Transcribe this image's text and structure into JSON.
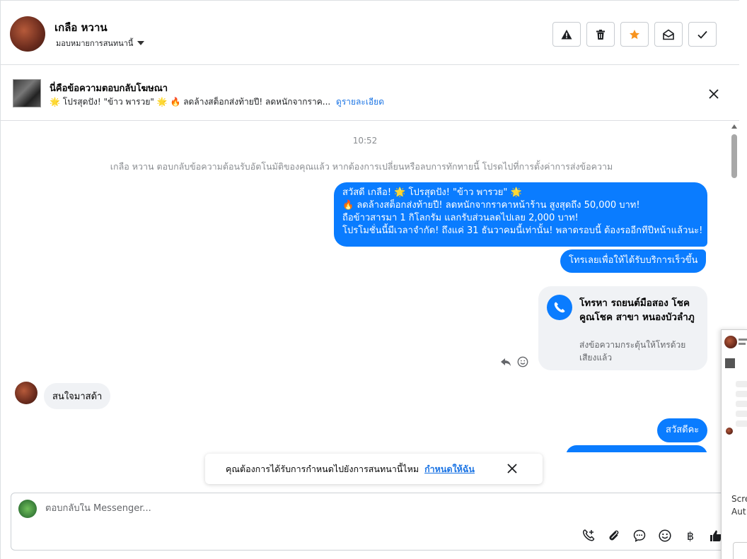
{
  "header": {
    "name": "เกลือ หวาน",
    "assign_label": "มอบหมายการสนทนานี้",
    "buttons": [
      {
        "icon": "warning-icon"
      },
      {
        "icon": "trash-icon"
      },
      {
        "icon": "star-icon",
        "color": "#f7931e"
      },
      {
        "icon": "envelope-open-icon"
      },
      {
        "icon": "check-icon"
      }
    ]
  },
  "ad": {
    "title": "นี่คือข้อความตอบกลับโฆษณา",
    "desc": "🌟 โปรสุดปัง! \"ข้าว พารวย\" 🌟 🔥 ลดล้างสต็อกส่งท้ายปี! ลดหนักจากราค...",
    "link": "ดูรายละเอียด"
  },
  "chat": {
    "time": "10:52",
    "system": "เกลือ หวาน ตอบกลับข้อความต้อนรับอัตโนมัติของคุณแล้ว หากต้องการเปลี่ยนหรือลบการทักทายนี้ โปรดไปที่การตั้งค่าการส่งข้อความ",
    "out1": [
      "สวัสดี เกลือ! 🌟 โปรสุดปัง! \"ข้าว พารวย\" 🌟",
      "🔥 ลดล้างสต็อกส่งท้ายปี! ลดหนักจากราคาหน้าร้าน สูงสุดถึง 50,000 บาท!",
      "ถือข้าวสารมา 1 กิโลกรัม แลกรับส่วนลดไปเลย 2,000 บาท!",
      "โปรโมชั่นนี้มีเวลาจำกัด! ถึงแค่ 31 ธันวาคมนี้เท่านั้น! พลาดรอบนี้ ต้องรออีกทีปีหน้าแล้วนะ!"
    ],
    "out2": "โทรเลยเพื่อให้ได้รับบริการเร็วขึ้น",
    "call_title": "โทรหา รถยนต์มือสอง โชคคูณโชค สาขา หนองบัวลำภู",
    "call_sub": "ส่งข้อความกระตุ้นให้โทรด้วยเสียงแล้ว",
    "in1": "สนใจมาสด้า",
    "out3": "สวัสดีคะ"
  },
  "toast": {
    "text": "คุณต้องการได้รับการกำหนดไปยังการสนทนานี้ไหม",
    "link": "กำหนดให้ฉัน"
  },
  "composer": {
    "placeholder": "ตอบกลับใน Messenger...",
    "tools": [
      "call-add-icon",
      "attachment-icon",
      "chat-bubble-icon",
      "emoji-icon",
      "baht-icon",
      "thumbs-up-icon"
    ],
    "baht_glyph": "฿"
  },
  "overlay": {
    "text1": "Scre",
    "text2": "Aut"
  }
}
